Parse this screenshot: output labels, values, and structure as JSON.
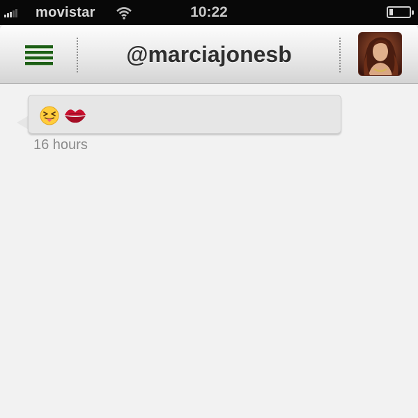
{
  "status_bar": {
    "carrier": "movistar",
    "time": "10:22",
    "signal_bars": 3,
    "battery_level": 0.2
  },
  "nav_bar": {
    "title": "@marciajonesb",
    "menu_icon": "list-icon",
    "avatar_icon": "profile-photo"
  },
  "messages": [
    {
      "emoji": [
        "laughing-face-tongue-emoji",
        "kiss-lips-emoji"
      ],
      "timestamp": "16 hours"
    }
  ],
  "colors": {
    "status_bar_bg": "#080808",
    "nav_title": "#2f2f2f",
    "menu_icon": "#1d5f16",
    "bubble_bg": "#e6e6e6",
    "timestamp": "#8a8a8a",
    "background": "#f2f2f2"
  }
}
